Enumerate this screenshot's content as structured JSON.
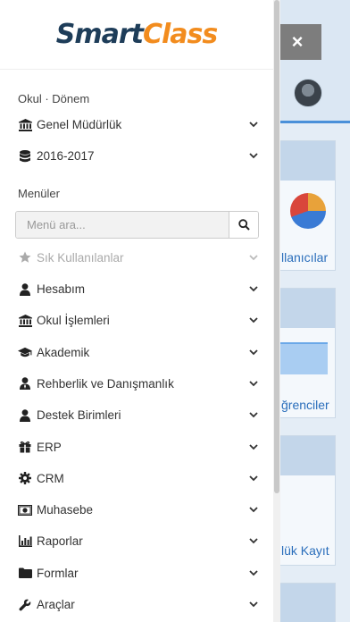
{
  "logo": {
    "smart": "Smart",
    "class": "Class"
  },
  "context": {
    "label": "Okul · Dönem",
    "items": [
      {
        "label": "Genel Müdürlük",
        "icon": "bank-icon"
      },
      {
        "label": "2016-2017",
        "icon": "database-icon"
      }
    ]
  },
  "menus_label": "Menüler",
  "search": {
    "placeholder": "Menü ara..."
  },
  "menu": [
    {
      "label": "Sık Kullanılanlar",
      "icon": "star-icon"
    },
    {
      "label": "Hesabım",
      "icon": "user-icon"
    },
    {
      "label": "Okul İşlemleri",
      "icon": "bank-icon"
    },
    {
      "label": "Akademik",
      "icon": "graduation-cap-icon"
    },
    {
      "label": "Rehberlik ve Danışmanlık",
      "icon": "user-tie-icon"
    },
    {
      "label": "Destek Birimleri",
      "icon": "user-icon"
    },
    {
      "label": "ERP",
      "icon": "gift-icon"
    },
    {
      "label": "CRM",
      "icon": "gear-icon"
    },
    {
      "label": "Muhasebe",
      "icon": "money-icon"
    },
    {
      "label": "Raporlar",
      "icon": "bar-chart-icon"
    },
    {
      "label": "Formlar",
      "icon": "folder-icon"
    },
    {
      "label": "Araçlar",
      "icon": "wrench-icon"
    }
  ],
  "background": {
    "close": "×",
    "card_links": [
      "llanıcılar",
      "ğrenciler",
      "lük Kayıt"
    ]
  }
}
